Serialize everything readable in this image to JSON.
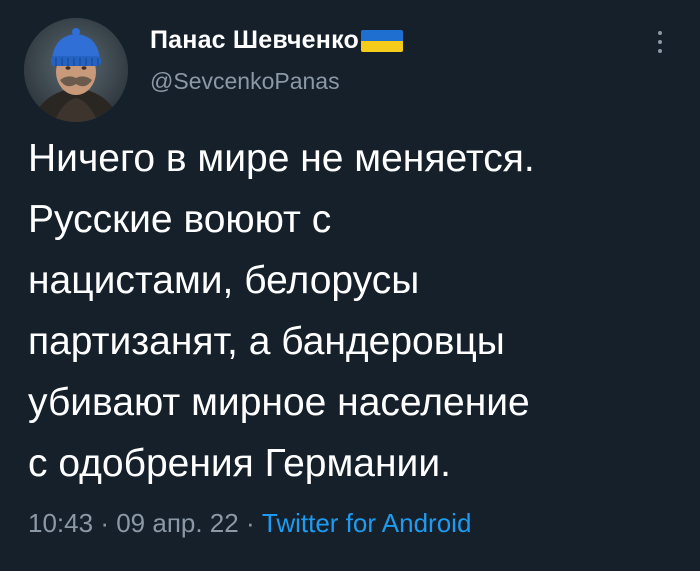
{
  "tweet": {
    "author": {
      "display_name": "Панас Шевченко",
      "handle": "@SevcenkoPanas",
      "avatar": "portrait-avatar",
      "flag_icon": "ukraine-flag-icon"
    },
    "more_icon": "vertical-dots-icon",
    "text_lines": [
      "Ничего в мире не меняется.",
      "Русские воюют с",
      "нацистами, белорусы",
      "партизанят, а бандеровцы",
      "убивают мирное население",
      "с одобрения Германии."
    ],
    "meta": {
      "time": "10:43",
      "separator": "·",
      "date": "09 апр. 22",
      "source": "Twitter for Android"
    }
  },
  "colors": {
    "background": "#15202b",
    "text_primary": "#ffffff",
    "text_secondary": "#8b98a5",
    "link": "#1d9bf0",
    "flag_blue": "#1f6fd1",
    "flag_yellow": "#f5cc1c"
  }
}
